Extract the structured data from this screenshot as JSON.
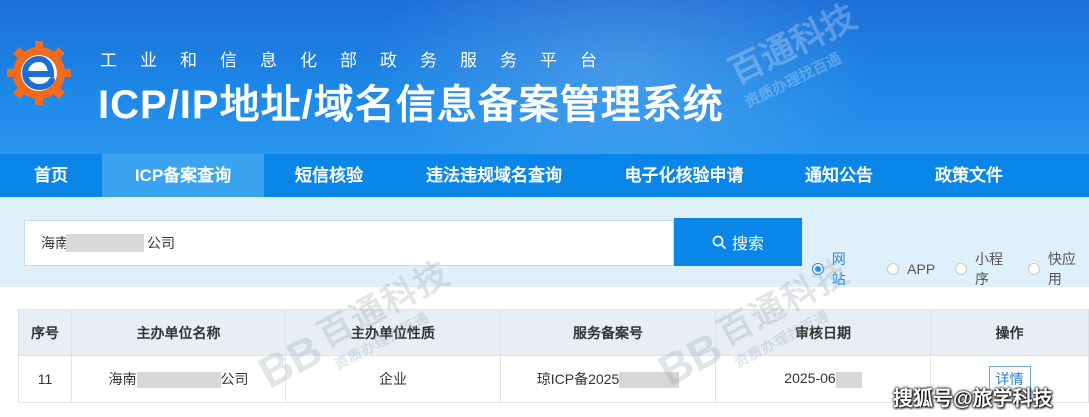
{
  "header": {
    "subtitle": "工业和信息化部政务服务平台",
    "title": "ICP/IP地址/域名信息备案管理系统"
  },
  "nav": [
    {
      "label": "首页",
      "active": false
    },
    {
      "label": "ICP备案查询",
      "active": true
    },
    {
      "label": "短信核验",
      "active": false
    },
    {
      "label": "违法违规域名查询",
      "active": false
    },
    {
      "label": "电子化核验申请",
      "active": false
    },
    {
      "label": "通知公告",
      "active": false
    },
    {
      "label": "政策文件",
      "active": false
    }
  ],
  "search": {
    "value_prefix": "海南",
    "value_suffix": "公司",
    "button_label": "搜索"
  },
  "filters": [
    {
      "label": "网站",
      "checked": true
    },
    {
      "label": "APP",
      "checked": false
    },
    {
      "label": "小程序",
      "checked": false
    },
    {
      "label": "快应用",
      "checked": false
    }
  ],
  "table": {
    "headers": [
      "序号",
      "主办单位名称",
      "主办单位性质",
      "服务备案号",
      "审核日期",
      "操作"
    ],
    "rows": [
      {
        "index": "11",
        "name_prefix": "海南",
        "name_suffix": "公司",
        "nature": "企业",
        "record_prefix": "琼ICP备2025",
        "date_prefix": "2025-06",
        "action": "详情"
      }
    ]
  },
  "watermark": {
    "brand": "百通科技",
    "slogan": "资质办理找百通",
    "logo_text": "BB"
  },
  "footer_mark": "搜狐号@旅学科技"
}
